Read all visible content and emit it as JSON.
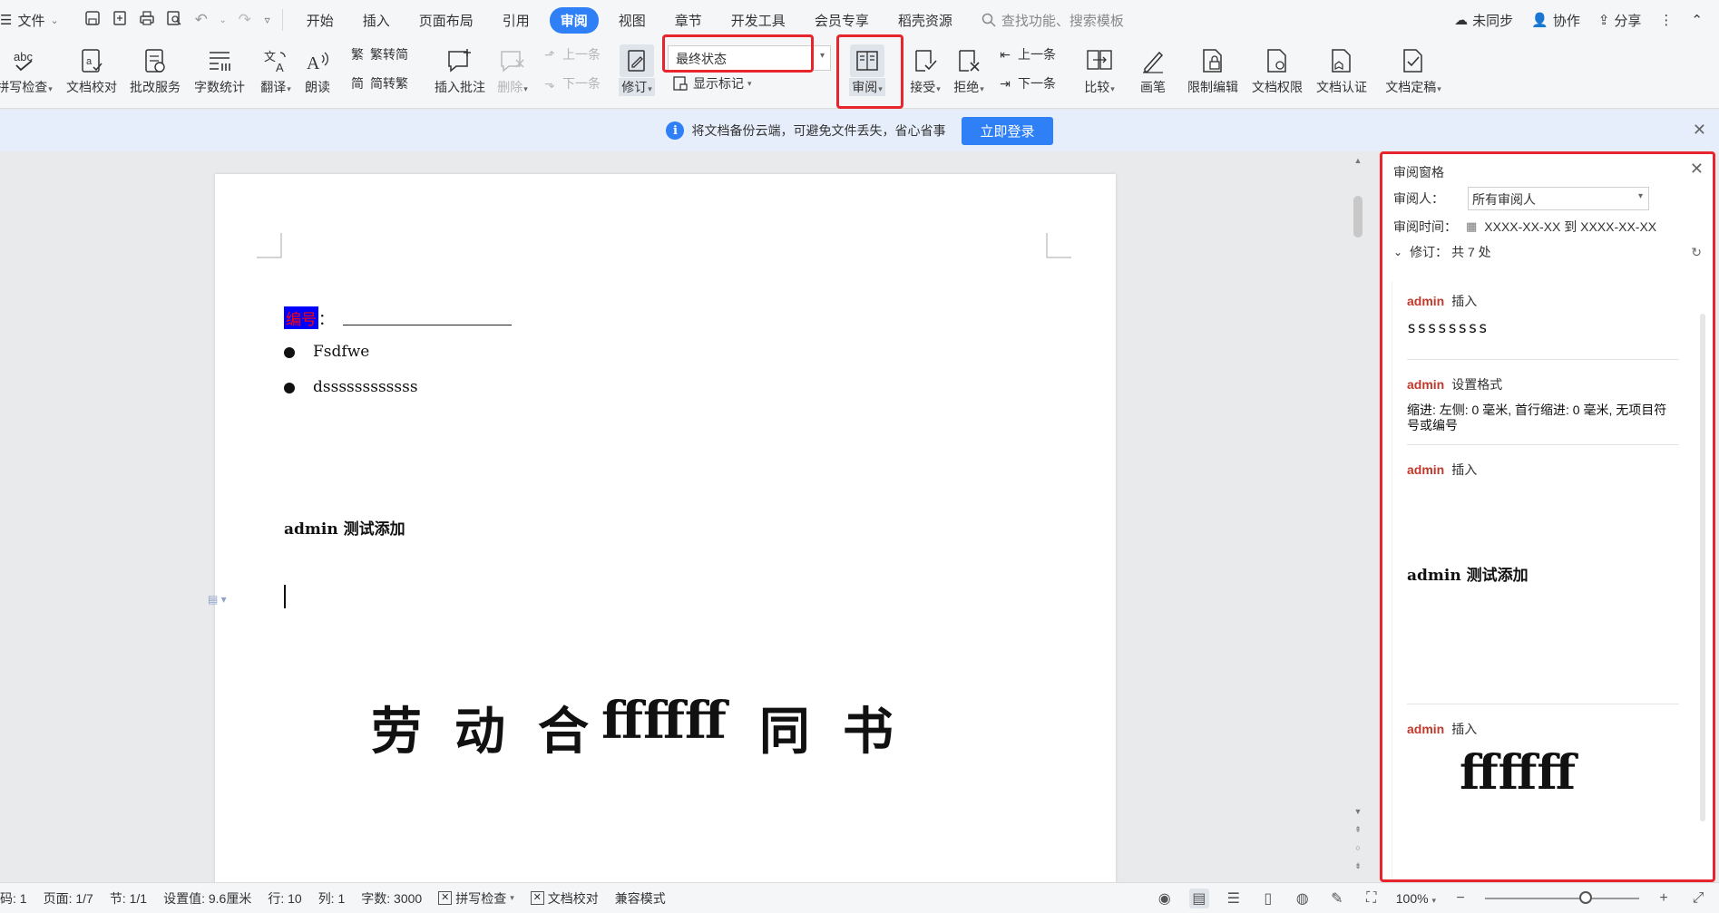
{
  "menu": {
    "file": "文件",
    "tabs": [
      "开始",
      "插入",
      "页面布局",
      "引用",
      "审阅",
      "视图",
      "章节",
      "开发工具",
      "会员专享",
      "稻壳资源"
    ],
    "active_tab": "审阅",
    "search_placeholder": "查找功能、搜索模板",
    "sync": "未同步",
    "collab": "协作",
    "share": "分享"
  },
  "ribbon": {
    "spell_check": "拼写检查",
    "doc_proofread": "文档校对",
    "correction_service": "批改服务",
    "word_count": "字数统计",
    "translate": "翻译",
    "read_aloud": "朗读",
    "trad_to_simp": "繁转简",
    "simp_to_trad": "简转繁",
    "insert_comment": "插入批注",
    "delete": "删除",
    "prev_comment": "上一条",
    "next_comment": "下一条",
    "track_changes": "修订",
    "display_mode": "最终状态",
    "show_markup": "显示标记",
    "review_pane": "审阅",
    "accept": "接受",
    "reject": "拒绝",
    "prev_change": "上一条",
    "next_change": "下一条",
    "compare": "比较",
    "pen": "画笔",
    "restrict_edit": "限制编辑",
    "doc_permission": "文档权限",
    "doc_auth": "文档认证",
    "doc_finalize": "文档定稿"
  },
  "notification": {
    "message": "将文档备份云端，可避免文件丢失，省心省事",
    "login_button": "立即登录"
  },
  "document": {
    "field_label": "编号",
    "field_colon": "：",
    "bullets": [
      "Fsdfwe",
      "dssssssssssss"
    ],
    "inserted_line": "admin 测试添加",
    "title_parts": [
      "劳",
      "动",
      "合",
      "ffffff",
      "同",
      "书"
    ]
  },
  "review_pane": {
    "title": "审阅窗格",
    "reviewer_label": "审阅人：",
    "reviewer_value": "所有审阅人",
    "time_label": "审阅时间：",
    "time_value": "XXXX-XX-XX 到 XXXX-XX-XX",
    "revisions_label": "修订：",
    "revisions_count": "共 7 处",
    "cards": [
      {
        "author": "admin",
        "action": "插入",
        "content": "ssssssss"
      },
      {
        "author": "admin",
        "action": "设置格式",
        "content": "缩进: 左侧: 0 毫米, 首行缩进: 0 毫米, 无项目符号或编号"
      },
      {
        "author": "admin",
        "action": "插入",
        "content": "admin 测试添加"
      },
      {
        "author": "admin",
        "action": "插入",
        "content": "ffffff"
      }
    ]
  },
  "status": {
    "page_code": "码: 1",
    "page": "页面: 1/7",
    "section": "节: 1/1",
    "position": "设置值: 9.6厘米",
    "line": "行: 10",
    "column": "列: 1",
    "word_count": "字数: 3000",
    "spell_check": "拼写检查",
    "doc_proofread": "文档校对",
    "compat_mode": "兼容模式",
    "zoom": "100%"
  },
  "colors": {
    "accent": "#2f7ff7",
    "highlight_red": "#e8242c",
    "author_red": "#c0392b",
    "field_bg": "#0000ff",
    "field_fg": "#ff0000"
  }
}
